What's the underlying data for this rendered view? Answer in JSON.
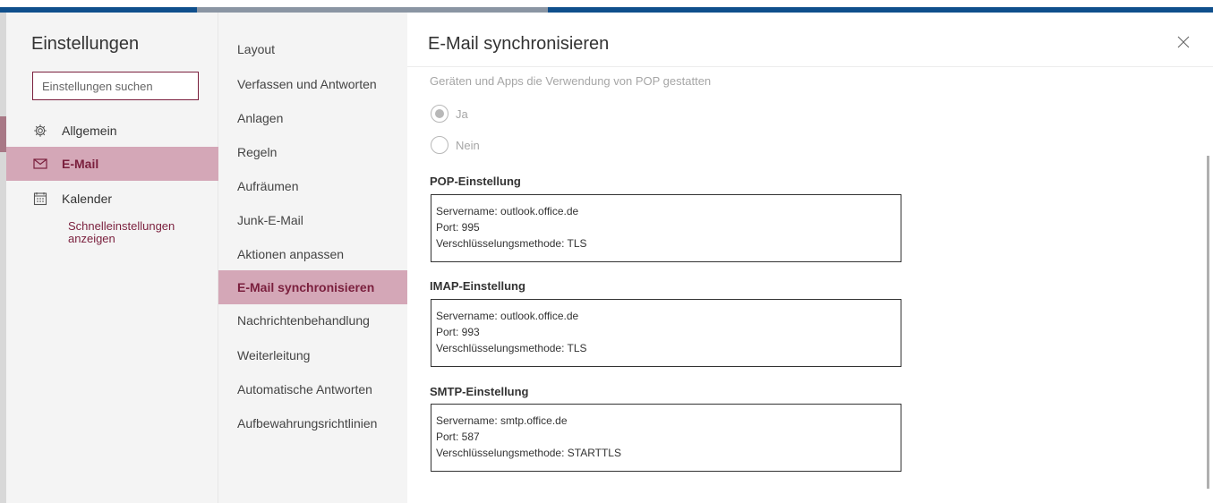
{
  "sidebar": {
    "title": "Einstellungen",
    "search_placeholder": "Einstellungen suchen",
    "items": [
      {
        "label": "Allgemein",
        "icon": "gear-icon",
        "active": false
      },
      {
        "label": "E-Mail",
        "icon": "mail-icon",
        "active": true
      },
      {
        "label": "Kalender",
        "icon": "calendar-icon",
        "active": false
      }
    ],
    "quick_settings_link": "Schnelleinstellungen anzeigen"
  },
  "submenu": {
    "items": [
      {
        "label": "Layout"
      },
      {
        "label": "Verfassen und Antworten"
      },
      {
        "label": "Anlagen"
      },
      {
        "label": "Regeln"
      },
      {
        "label": "Aufräumen"
      },
      {
        "label": "Junk-E-Mail"
      },
      {
        "label": "Aktionen anpassen"
      },
      {
        "label": "E-Mail synchronisieren",
        "active": true
      },
      {
        "label": "Nachrichtenbehandlung"
      },
      {
        "label": "Weiterleitung"
      },
      {
        "label": "Automatische Antworten"
      },
      {
        "label": "Aufbewahrungsrichtlinien"
      }
    ]
  },
  "main": {
    "title": "E-Mail synchronisieren",
    "close_icon": "close-icon",
    "pop_question": "Geräten und Apps die Verwendung von POP gestatten",
    "pop_options": [
      {
        "label": "Ja",
        "selected": true
      },
      {
        "label": "Nein",
        "selected": false
      }
    ],
    "sections": [
      {
        "heading": "POP-Einstellung",
        "server": "Servername: outlook.office.de",
        "port": "Port: 995",
        "encryption": "Verschlüsselungsmethode: TLS"
      },
      {
        "heading": "IMAP-Einstellung",
        "server": "Servername: outlook.office.de",
        "port": "Port: 993",
        "encryption": "Verschlüsselungsmethode: TLS"
      },
      {
        "heading": "SMTP-Einstellung",
        "server": "Servername: smtp.office.de",
        "port": "Port: 587",
        "encryption": "Verschlüsselungsmethode: STARTTLS"
      }
    ]
  },
  "colors": {
    "accent": "#7a1f3d",
    "active_bg": "#d4a7b7",
    "top_bar": "#0f4f8c"
  }
}
